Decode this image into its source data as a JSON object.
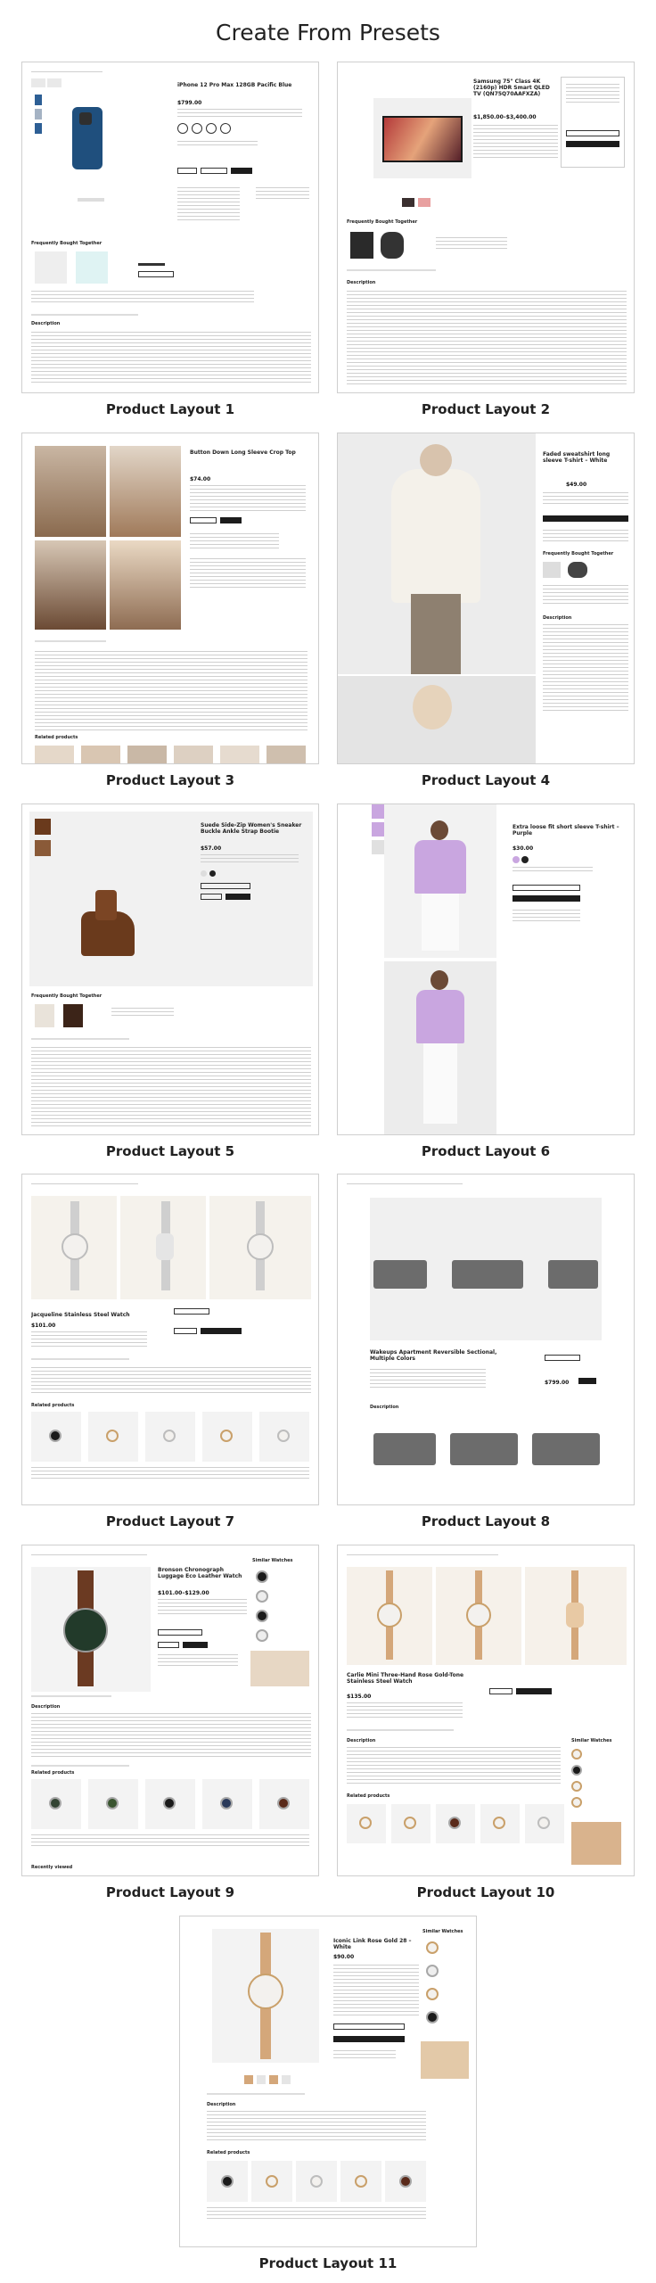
{
  "page": {
    "title": "Create From Presets"
  },
  "cards": [
    {
      "label": "Product Layout 1",
      "product": "iPhone 12 Pro Max 128GB Pacific Blue",
      "price": "$799.00"
    },
    {
      "label": "Product Layout 2",
      "product": "Samsung 75\" Class 4K (2160p) HDR Smart QLED TV (QN75Q70AAFXZA)",
      "price": "$1,850.00–$3,400.00"
    },
    {
      "label": "Product Layout 3",
      "product": "Button Down Long Sleeve Crop Top",
      "price": "$74.00"
    },
    {
      "label": "Product Layout 4",
      "product": "Faded sweatshirt long sleeve T-shirt – White",
      "price": "$49.00"
    },
    {
      "label": "Product Layout 5",
      "product": "Suede Side-Zip Women's Sneaker Buckle Ankle Strap Bootie",
      "price": "$57.00"
    },
    {
      "label": "Product Layout 6",
      "product": "Extra loose fit short sleeve T-shirt – Purple",
      "price": "$30.00"
    },
    {
      "label": "Product Layout 7",
      "product": "Jacqueline Stainless Steel Watch",
      "price": "$101.00"
    },
    {
      "label": "Product Layout 8",
      "product": "Wakeups Apartment Reversible Sectional, Multiple Colors",
      "price": "$799.00"
    },
    {
      "label": "Product Layout 9",
      "product": "Bronson Chronograph Luggage Eco Leather Watch",
      "price": "$101.00–$129.00"
    },
    {
      "label": "Product Layout 10",
      "product": "Carlie Mini Three-Hand Rose Gold-Tone Stainless Steel Watch",
      "price": "$135.00"
    },
    {
      "label": "Product Layout 11",
      "product": "Iconic Link Rose Gold 28 – White",
      "price": "$90.00"
    }
  ],
  "colors": {
    "accent": "#1c1c1c",
    "border": "#cfcfcf",
    "phone_blue": "#24558a",
    "purple": "#c9a6e0",
    "boot_brown": "#6a3a1c"
  }
}
